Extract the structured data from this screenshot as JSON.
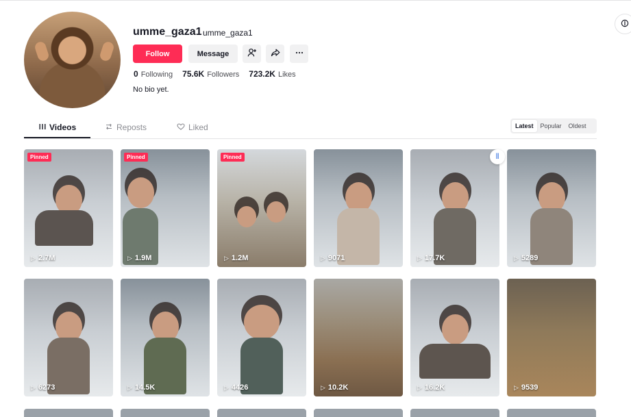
{
  "profile": {
    "username": "umme_gaza1",
    "nickname": "umme_gaza1",
    "follow_label": "Follow",
    "message_label": "Message",
    "stats": {
      "following": "0",
      "following_label": "Following",
      "followers": "75.6K",
      "followers_label": "Followers",
      "likes": "723.2K",
      "likes_label": "Likes"
    },
    "bio": "No bio yet."
  },
  "icons": {
    "add_friend": "add-friend-icon",
    "share": "share-icon",
    "more": "more-icon",
    "corner": "sidebar-toggle-icon",
    "videos_tab": "grid-icon",
    "reposts_tab": "repost-icon",
    "liked_tab": "heart-icon",
    "play": "play-icon",
    "audio": "audio-icon"
  },
  "tabs": [
    {
      "label": "Videos",
      "active": true
    },
    {
      "label": "Reposts",
      "active": false
    },
    {
      "label": "Liked",
      "active": false
    }
  ],
  "sort": [
    {
      "label": "Latest",
      "active": true
    },
    {
      "label": "Popular",
      "active": false
    },
    {
      "label": "Oldest",
      "active": false
    }
  ],
  "videos": [
    {
      "views": "2.7M",
      "pinned": "Pinned"
    },
    {
      "views": "1.9M",
      "pinned": "Pinned"
    },
    {
      "views": "1.2M",
      "pinned": "Pinned"
    },
    {
      "views": "9071",
      "pinned": ""
    },
    {
      "views": "17.7K",
      "pinned": ""
    },
    {
      "views": "5289",
      "pinned": ""
    },
    {
      "views": "6273",
      "pinned": ""
    },
    {
      "views": "14.5K",
      "pinned": ""
    },
    {
      "views": "4426",
      "pinned": ""
    },
    {
      "views": "10.2K",
      "pinned": ""
    },
    {
      "views": "16.2K",
      "pinned": ""
    },
    {
      "views": "9539",
      "pinned": ""
    }
  ],
  "colors": {
    "brand": "#fe2c55",
    "text": "#161823",
    "muted": "#8a8b91"
  }
}
